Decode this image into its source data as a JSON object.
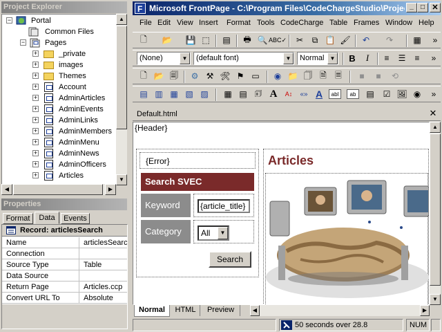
{
  "project_explorer": {
    "title": "Project Explorer",
    "root": "Portal",
    "nodes": [
      {
        "label": "Common Files",
        "kind": "page-group"
      },
      {
        "label": "Pages",
        "kind": "pages"
      },
      {
        "label": "_private",
        "kind": "folder"
      },
      {
        "label": "images",
        "kind": "folder"
      },
      {
        "label": "Themes",
        "kind": "folder"
      },
      {
        "label": "Account",
        "kind": "page"
      },
      {
        "label": "AdminArticles",
        "kind": "page"
      },
      {
        "label": "AdminEvents",
        "kind": "page"
      },
      {
        "label": "AdminLinks",
        "kind": "page"
      },
      {
        "label": "AdminMembers",
        "kind": "page"
      },
      {
        "label": "AdminMenu",
        "kind": "page"
      },
      {
        "label": "AdminNews",
        "kind": "page"
      },
      {
        "label": "AdminOfficers",
        "kind": "page"
      },
      {
        "label": "Articles",
        "kind": "page"
      }
    ]
  },
  "properties": {
    "title": "Properties",
    "tabs": [
      "Format",
      "Data",
      "Events"
    ],
    "active_tab": "Data",
    "record_label": "Record: articlesSearch",
    "rows": [
      {
        "key": "Name",
        "value": "articlesSearch"
      },
      {
        "key": "Connection",
        "value": ""
      },
      {
        "key": "Source Type",
        "value": "Table"
      },
      {
        "key": "Data Source",
        "value": ""
      },
      {
        "key": "Return Page",
        "value": "Articles.ccp"
      },
      {
        "key": "Convert URL To",
        "value": "Absolute"
      }
    ]
  },
  "window": {
    "title": "Microsoft FrontPage - C:\\Program Files\\CodeChargeStudio\\Project"
  },
  "menu": [
    "File",
    "Edit",
    "View",
    "Insert",
    "Format",
    "Tools",
    "CodeCharge",
    "Table",
    "Frames",
    "Window",
    "Help"
  ],
  "format_bar": {
    "style": "(None)",
    "font": "(default font)",
    "size": "Normal",
    "bold": "B",
    "italic": "I"
  },
  "document": {
    "tab_name": "Default.html",
    "header_placeholder": "{Header}",
    "error_placeholder": "{Error}",
    "search_title": "Search SVEC",
    "keyword_label": "Keyword",
    "keyword_value": "{article_title}",
    "category_label": "Category",
    "category_value": "All",
    "search_button": "Search",
    "articles_heading": "Articles"
  },
  "view_tabs": [
    "Normal",
    "HTML",
    "Preview"
  ],
  "active_view": "Normal",
  "status": {
    "message": "50 seconds over 28.8",
    "num": "NUM"
  },
  "colors": {
    "accent_red": "#7a2a2a",
    "articles_heading": "#7a2a2a",
    "title_blue": "#0a246a"
  }
}
